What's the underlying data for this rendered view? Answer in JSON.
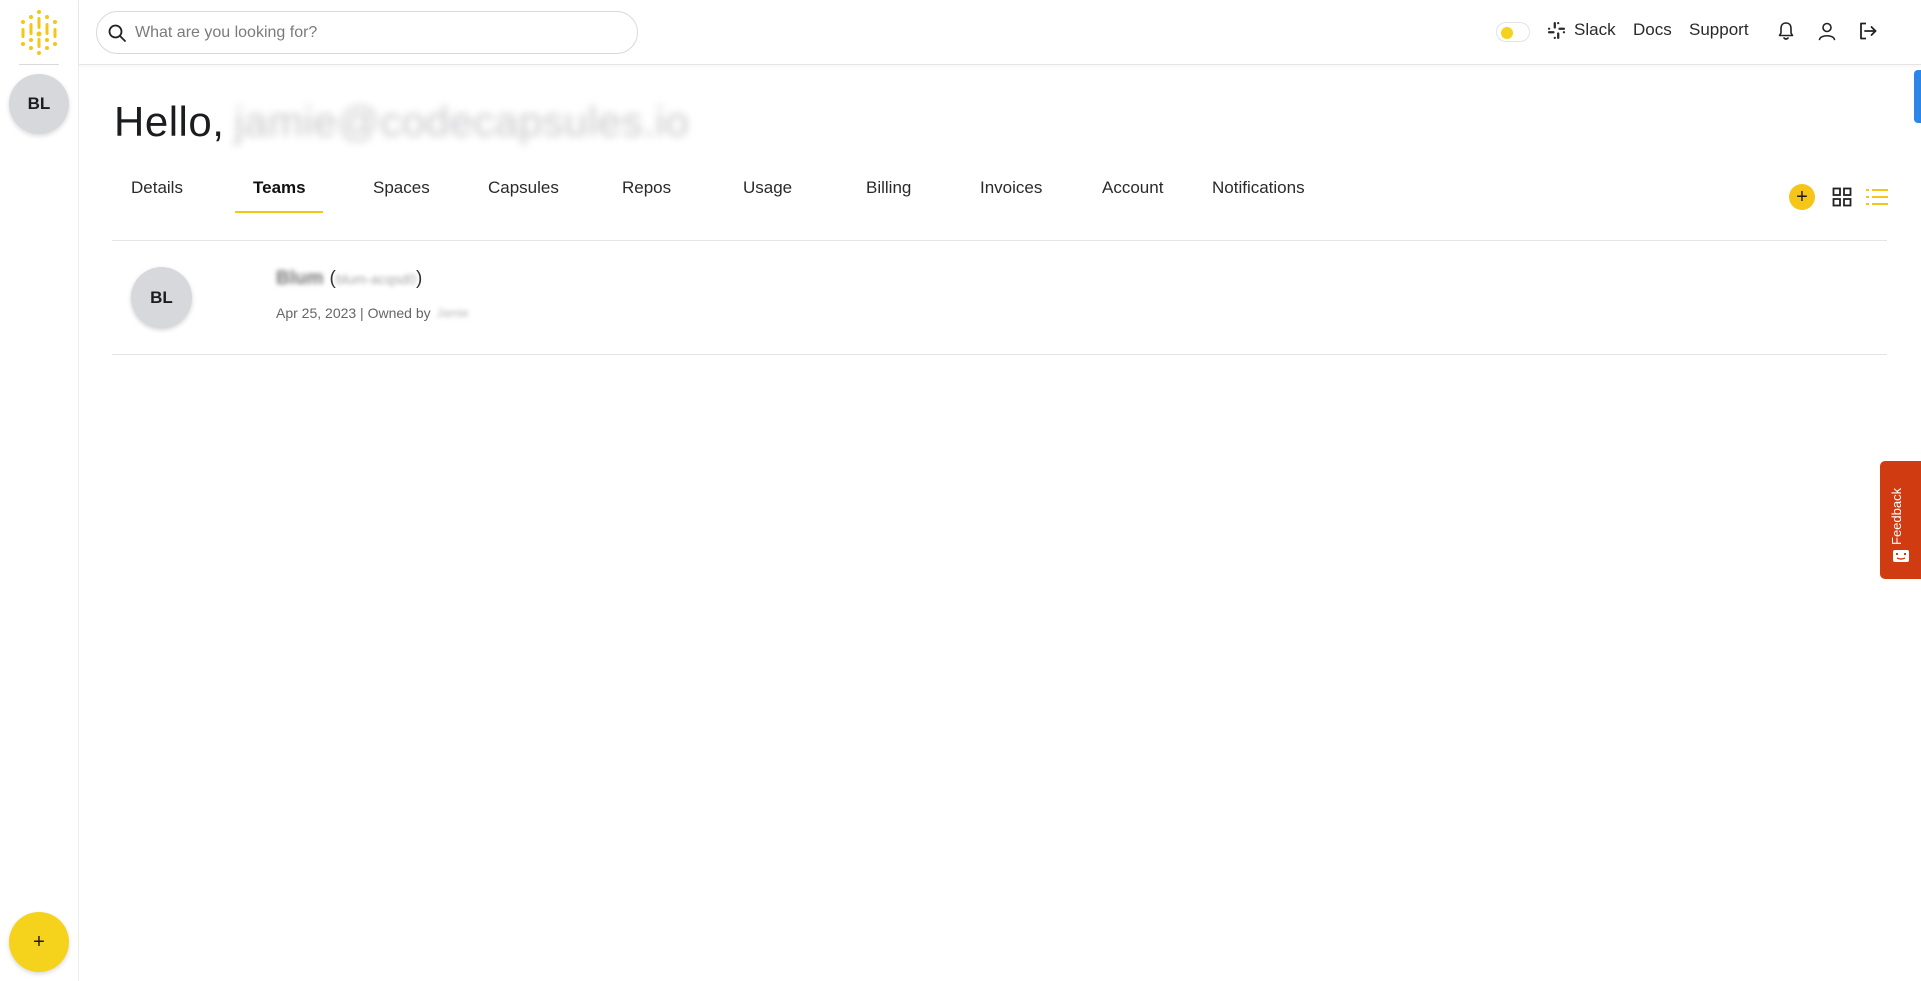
{
  "sidebar": {
    "avatar_initials": "BL",
    "add_label": "+"
  },
  "topbar": {
    "search": {
      "placeholder": "What are you looking for?"
    },
    "links": {
      "slack": "Slack",
      "docs": "Docs",
      "support": "Support"
    },
    "theme_toggle_color": "#f5d21c"
  },
  "main": {
    "greeting": "Hello,",
    "user_email": "jamie@codecapsules.io",
    "tabs": [
      {
        "label": "Details"
      },
      {
        "label": "Teams"
      },
      {
        "label": "Spaces"
      },
      {
        "label": "Capsules"
      },
      {
        "label": "Repos"
      },
      {
        "label": "Usage"
      },
      {
        "label": "Billing"
      },
      {
        "label": "Invoices"
      },
      {
        "label": "Account"
      },
      {
        "label": "Notifications"
      }
    ],
    "active_tab": "Teams",
    "add_label": "+",
    "teams": [
      {
        "initials": "BL",
        "name": "Blum",
        "slug": "blum-acqsd0",
        "created": "Apr 25, 2023 | Owned by",
        "owner": "Jamie"
      }
    ]
  },
  "feedback": {
    "label": "Feedback"
  },
  "colors": {
    "accent": "#f5c518",
    "feedback": "#d13b12",
    "edge_tab": "#2b86e8"
  }
}
